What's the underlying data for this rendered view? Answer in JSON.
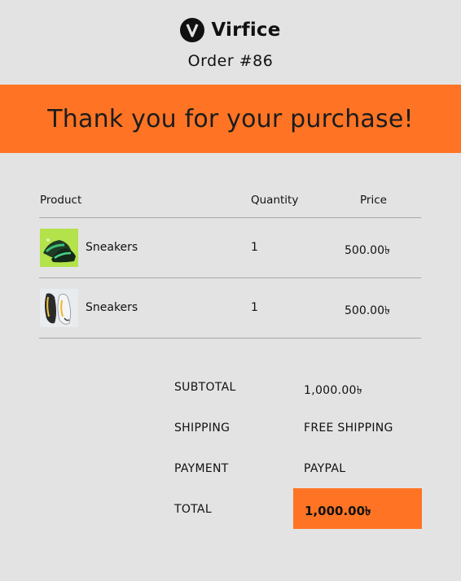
{
  "brand": {
    "name": "Virfice",
    "logo_icon": "v-letter-logo-icon"
  },
  "order": {
    "number": "Order #86"
  },
  "banner": {
    "message": "Thank you for your purchase!",
    "color": "#ff7424"
  },
  "table": {
    "headers": {
      "product": "Product",
      "quantity": "Quantity",
      "price": "Price"
    },
    "rows": [
      {
        "name": "Sneakers",
        "quantity": "1",
        "price": "500.00৳",
        "image": "green-sneakers-image"
      },
      {
        "name": "Sneakers",
        "quantity": "1",
        "price": "500.00৳",
        "image": "white-sneakers-image"
      }
    ]
  },
  "totals": {
    "subtotal_label": "SUBTOTAL",
    "subtotal_value": "1,000.00৳",
    "shipping_label": "SHIPPING",
    "shipping_value": "FREE SHIPPING",
    "payment_label": "PAYMENT",
    "payment_value": "PAYPAL",
    "total_label": "TOTAL",
    "total_value": "1,000.00৳"
  },
  "colors": {
    "accent": "#ff7424",
    "background": "#e3e3e3",
    "text": "#111111",
    "rule": "#a9a9a9"
  }
}
